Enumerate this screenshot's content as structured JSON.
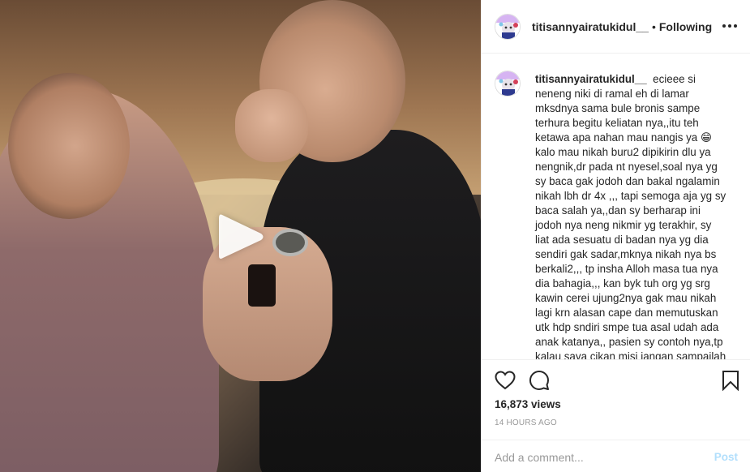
{
  "post": {
    "username": "titisannyairatukidul__",
    "separator": "•",
    "follow_status": "Following",
    "more_icon": "more-horizontal-icon"
  },
  "caption": {
    "username": "titisannyairatukidul__",
    "text": "ecieee si neneng niki di ramal eh di lamar mksdnya sama bule bronis sampe terhura begitu keliatan nya,,itu teh ketawa apa nahan mau nangis ya 😁 kalo mau nikah buru2 dipikirin dlu ya nengnik,dr pada nt nyesel,soal nya yg sy baca gak jodoh dan bakal ngalamin nikah lbh dr 4x ,,, tapi semoga aja yg sy baca salah ya,,dan sy berharap ini jodoh nya neng nikmir yg terakhir, sy liat ada sesuatu di badan nya yg dia sendiri gak sadar,mknya nikah nya bs berkali2,,, tp insha Alloh masa tua nya dia bahagia,,, kan byk tuh org yg srg kawin cerei ujung2nya gak mau nikah lagi krn alasan cape dan memutuskan utk hdp sndiri smpe tua asal udah ada anak katanya,, pasien sy contoh nya,tp kalau saya cikan misi jangan sampailah"
  },
  "actions": {
    "like_icon": "heart-icon",
    "comment_icon": "comment-bubble-icon",
    "save_icon": "bookmark-icon"
  },
  "stats": {
    "views": "16,873 views",
    "timestamp": "14 HOURS AGO"
  },
  "comment": {
    "placeholder": "Add a comment...",
    "post_label": "Post"
  },
  "media": {
    "type": "video",
    "play_icon": "play-icon"
  },
  "colors": {
    "border": "#efefef",
    "text": "#262626",
    "muted": "#999999",
    "post_disabled": "#b2dffc"
  }
}
